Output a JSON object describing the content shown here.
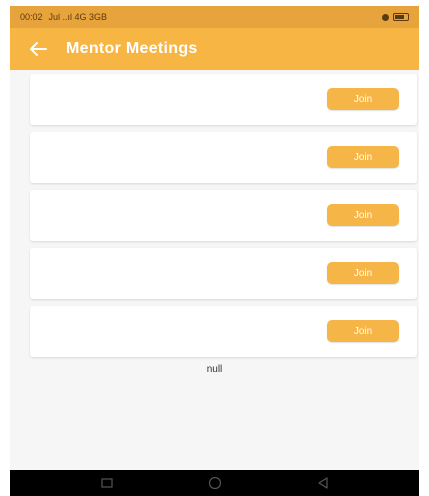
{
  "status_bar": {
    "time": "00:02",
    "signal_text": "Jul ..ıl 4G 3GB"
  },
  "header": {
    "title": "Mentor Meetings",
    "back_icon": "arrow-left-icon",
    "color": "#f7b544"
  },
  "meetings": [
    {
      "button_label": "Join"
    },
    {
      "button_label": "Join"
    },
    {
      "button_label": "Join"
    },
    {
      "button_label": "Join"
    },
    {
      "button_label": "Join"
    }
  ],
  "footer_text": "null",
  "nav": {
    "items": [
      "recents-icon",
      "home-icon",
      "back-icon"
    ]
  }
}
